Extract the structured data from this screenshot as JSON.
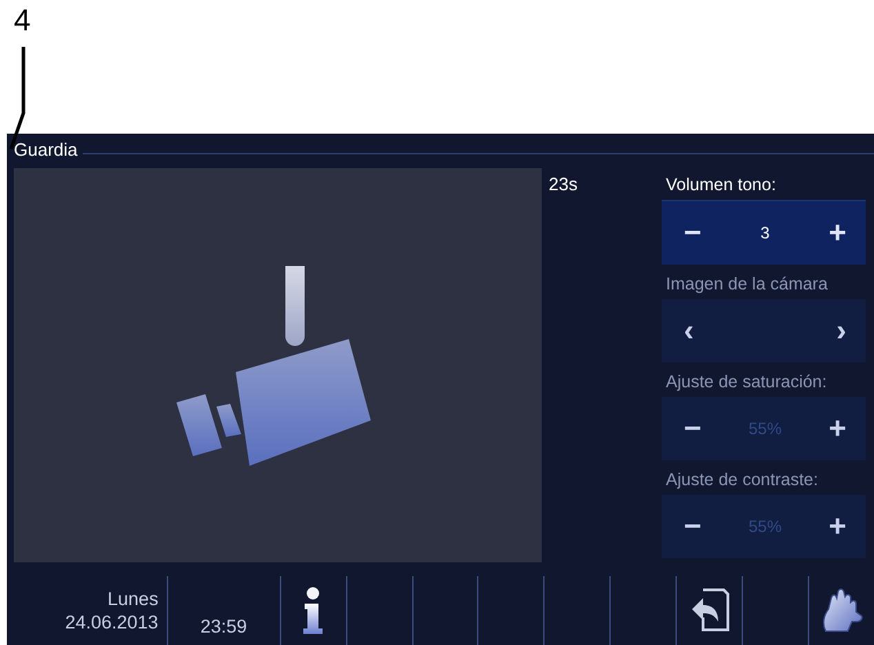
{
  "callout": "4",
  "window": {
    "title": "Guardia"
  },
  "video": {
    "timer": "23s"
  },
  "settings": [
    {
      "label": "Volumen tono:",
      "kind": "stepper",
      "active": true,
      "value": "3",
      "minus": "−",
      "plus": "+"
    },
    {
      "label": "Imagen de la cámara",
      "kind": "arrows",
      "active": false,
      "prev": "‹",
      "next": "›"
    },
    {
      "label": "Ajuste de saturación:",
      "kind": "stepper",
      "active": false,
      "value": "55%",
      "minus": "−",
      "plus": "+"
    },
    {
      "label": "Ajuste de contraste:",
      "kind": "stepper",
      "active": false,
      "value": "55%",
      "minus": "−",
      "plus": "+"
    }
  ],
  "status_bar": {
    "day": "Lunes",
    "date": "24.06.2013",
    "time": "23:59",
    "slots": [
      {
        "kind": "info"
      },
      {
        "kind": "empty"
      },
      {
        "kind": "empty"
      },
      {
        "kind": "empty"
      },
      {
        "kind": "empty"
      },
      {
        "kind": "empty"
      },
      {
        "kind": "back"
      },
      {
        "kind": "empty"
      },
      {
        "kind": "hand"
      }
    ]
  }
}
